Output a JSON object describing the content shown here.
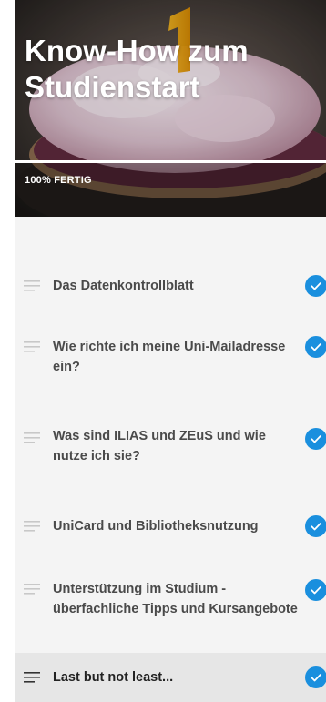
{
  "course": {
    "title": "Know-How zum Studienstart",
    "progress_label": "100% FERTIG",
    "progress_fraction": 1.0
  },
  "lessons": [
    {
      "label": "Das Datenkontrollblatt",
      "completed": true,
      "active": false,
      "icon": "menu-icon"
    },
    {
      "label": "Wie richte ich meine Uni-Mailadresse ein?",
      "completed": true,
      "active": false,
      "icon": "menu-icon"
    },
    {
      "label": "Was sind ILIAS und ZEuS und wie nutze ich sie?",
      "completed": true,
      "active": false,
      "icon": "menu-icon"
    },
    {
      "label": "UniCard und Bibliotheksnutzung",
      "completed": true,
      "active": false,
      "icon": "menu-icon"
    },
    {
      "label": "Unterstützung im Studium - überfachliche Tipps und Kursangebote",
      "completed": true,
      "active": false,
      "icon": "menu-icon"
    },
    {
      "label": "Last but not least...",
      "completed": true,
      "active": true,
      "icon": "menu-icon"
    }
  ],
  "colors": {
    "accent": "#1a8fde",
    "sidebar_bg": "#f4f4f4",
    "active_row_bg": "#e6e6e6",
    "text": "#4a4a4a"
  }
}
